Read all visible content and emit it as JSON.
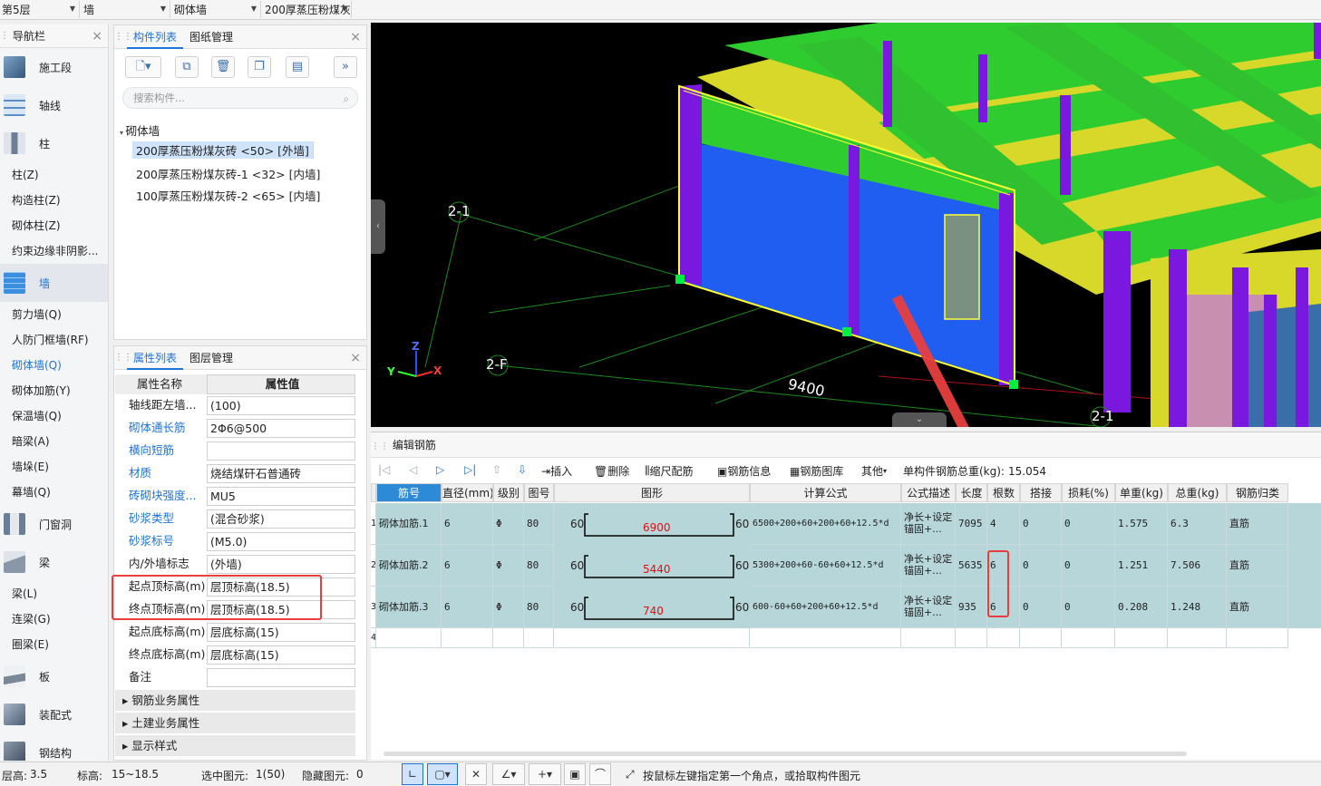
{
  "selectors": [
    {
      "value": "第5层"
    },
    {
      "value": "墙"
    },
    {
      "value": "砌体墙"
    },
    {
      "value": "200厚蒸压粉煤灰"
    }
  ],
  "nav": {
    "title": "导航栏",
    "categories": [
      {
        "label": "施工段",
        "color": "#4a6d94"
      },
      {
        "label": "轴线",
        "color": "#5e8ec7"
      },
      {
        "label": "柱",
        "color": "#7c8b9f"
      }
    ],
    "column_items": [
      "柱(Z)",
      "构造柱(Z)",
      "砌体柱(Z)",
      "约束边缘非阴影..."
    ],
    "wall_category": {
      "label": "墙",
      "color": "#3b8fe0"
    },
    "wall_items": [
      "剪力墙(Q)",
      "人防门框墙(RF)",
      "砌体墙(Q)",
      "砌体加筋(Y)",
      "保温墙(Q)",
      "暗梁(A)",
      "墙垛(E)",
      "幕墙(Q)"
    ],
    "active_wall_item": "砌体墙(Q)",
    "door_category": {
      "label": "门窗洞",
      "color": "#6a7f97"
    },
    "beam_category": {
      "label": "梁",
      "color": "#8a97a8"
    },
    "beam_items": [
      "梁(L)",
      "连梁(G)",
      "圈梁(E)"
    ],
    "more_categories": [
      {
        "label": "板",
        "color": "#7b8898"
      },
      {
        "label": "装配式",
        "color": "#6b7d90"
      },
      {
        "label": "钢结构",
        "color": "#5a6b7e"
      }
    ]
  },
  "component_panel": {
    "tabs": [
      "构件列表",
      "图纸管理"
    ],
    "search_placeholder": "搜索构件...",
    "tree_root": "砌体墙",
    "items": [
      "200厚蒸压粉煤灰砖 <50> [外墙]",
      "200厚蒸压粉煤灰砖-1 <32> [内墙]",
      "100厚蒸压粉煤灰砖-2 <65> [内墙]"
    ],
    "selected_index": 0
  },
  "property_panel": {
    "tabs": [
      "属性列表",
      "图层管理"
    ],
    "col_name": "属性名称",
    "col_value": "属性值",
    "rows": [
      {
        "name": "轴线距左墙...",
        "value": "(100)",
        "link": false
      },
      {
        "name": "砌体通长筋",
        "value": "2Φ6@500",
        "link": true
      },
      {
        "name": "横向短筋",
        "value": "",
        "link": true
      },
      {
        "name": "材质",
        "value": "烧结煤矸石普通砖",
        "link": true
      },
      {
        "name": "砖砌块强度...",
        "value": "MU5",
        "link": true
      },
      {
        "name": "砂浆类型",
        "value": "(混合砂浆)",
        "link": true
      },
      {
        "name": "砂浆标号",
        "value": "(M5.0)",
        "link": true
      },
      {
        "name": "内/外墙标志",
        "value": "(外墙)",
        "link": false
      },
      {
        "name": "起点顶标高(m)",
        "value": "层顶标高(18.5)",
        "link": false
      },
      {
        "name": "终点顶标高(m)",
        "value": "层顶标高(18.5)",
        "link": false
      },
      {
        "name": "起点底标高(m)",
        "value": "层底标高(15)",
        "link": false
      },
      {
        "name": "终点底标高(m)",
        "value": "层底标高(15)",
        "link": false
      },
      {
        "name": "备注",
        "value": "",
        "link": false
      }
    ],
    "groups": [
      "钢筋业务属性",
      "土建业务属性",
      "显示样式"
    ]
  },
  "view3d": {
    "axis_labels": [
      "2-1",
      "2-F",
      "2-1"
    ],
    "dimension": "9400",
    "axes": {
      "x": "X",
      "y": "Y",
      "z": "Z"
    }
  },
  "rebar_editor": {
    "title": "编辑钢筋",
    "toolbar": {
      "insert": "插入",
      "delete": "删除",
      "scale": "缩尺配筋",
      "info": "钢筋信息",
      "library": "钢筋图库",
      "other": "其他",
      "weight_label": "单构件钢筋总重(kg):",
      "weight_value": "15.054"
    },
    "columns": [
      "筋号",
      "直径(mm)",
      "级别",
      "图号",
      "图形",
      "计算公式",
      "公式描述",
      "长度",
      "根数",
      "搭接",
      "损耗(%)",
      "单重(kg)",
      "总重(kg)",
      "钢筋归类"
    ],
    "rows": [
      {
        "idx": "1",
        "name": "砌体加筋.1",
        "dia": "6",
        "grade": "Φ",
        "fig": "80",
        "left": "60",
        "mid": "6900",
        "right": "60",
        "formula": "6500+200+60+200+60+12.5*d",
        "desc1": "净长+设定",
        "desc2": "锚固+...",
        "len": "7095",
        "count": "4",
        "lap": "0",
        "loss": "0",
        "unit": "1.575",
        "total": "6.3",
        "cat": "直筋"
      },
      {
        "idx": "2",
        "name": "砌体加筋.2",
        "dia": "6",
        "grade": "Φ",
        "fig": "80",
        "left": "60",
        "mid": "5440",
        "right": "60",
        "formula": "5300+200+60-60+60+12.5*d",
        "desc1": "净长+设定",
        "desc2": "锚固+...",
        "len": "5635",
        "count": "6",
        "lap": "0",
        "loss": "0",
        "unit": "1.251",
        "total": "7.506",
        "cat": "直筋"
      },
      {
        "idx": "3",
        "name": "砌体加筋.3",
        "dia": "6",
        "grade": "Φ",
        "fig": "80",
        "left": "60",
        "mid": "740",
        "right": "60",
        "formula": "600-60+60+200+60+12.5*d",
        "desc1": "净长+设定",
        "desc2": "锚固+...",
        "len": "935",
        "count": "6",
        "lap": "0",
        "loss": "0",
        "unit": "0.208",
        "total": "1.248",
        "cat": "直筋"
      }
    ],
    "empty_row_idx": "4"
  },
  "status": {
    "floor_height_label": "层高:",
    "floor_height": "3.5",
    "elev_label": "标高:",
    "elev": "15~18.5",
    "selected_label": "选中图元:",
    "selected": "1(50)",
    "hidden_label": "隐藏图元:",
    "hidden": "0",
    "hint": "按鼠标左键指定第一个角点，或拾取构件图元"
  }
}
